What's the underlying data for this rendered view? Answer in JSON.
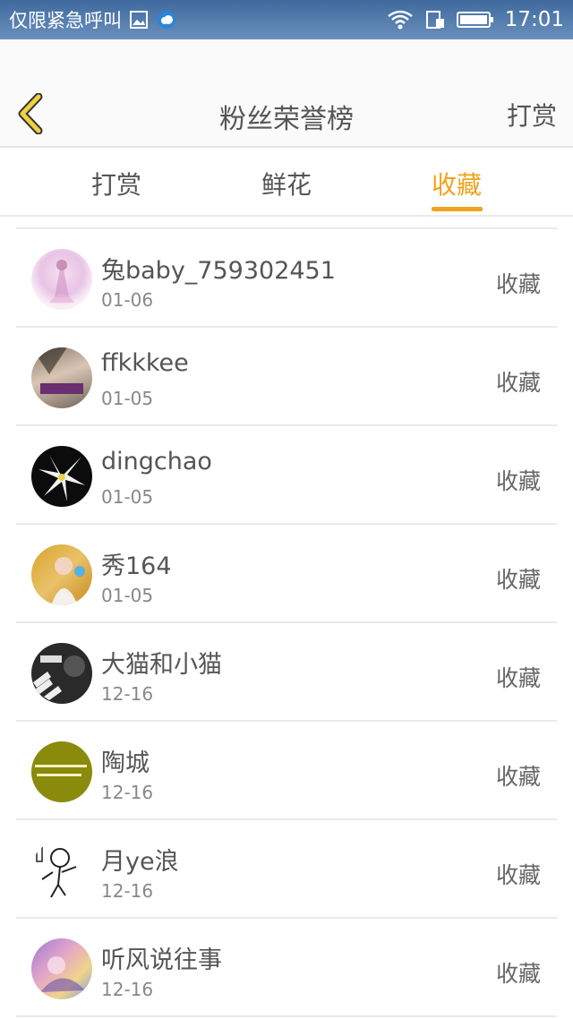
{
  "status_bar": {
    "left_text": "仅限紧急呼叫",
    "time": "17:01"
  },
  "header": {
    "title": "粉丝荣誉榜",
    "action_label": "打赏"
  },
  "tabs": [
    {
      "label": "打赏",
      "active": false
    },
    {
      "label": "鲜花",
      "active": false
    },
    {
      "label": "收藏",
      "active": true
    }
  ],
  "colors": {
    "accent": "#f0a31c",
    "status_bar": "#4a73a6"
  },
  "fans": [
    {
      "name": "兔baby_759302451",
      "date": "01-06",
      "action": "收藏"
    },
    {
      "name": "ffkkkee",
      "date": "01-05",
      "action": "收藏"
    },
    {
      "name": "dingchao",
      "date": "01-05",
      "action": "收藏"
    },
    {
      "name": "秀164",
      "date": "01-05",
      "action": "收藏"
    },
    {
      "name": "大猫和小猫",
      "date": "12-16",
      "action": "收藏"
    },
    {
      "name": "陶城",
      "date": "12-16",
      "action": "收藏"
    },
    {
      "name": "月ye浪",
      "date": "12-16",
      "action": "收藏"
    },
    {
      "name": "听风说往事",
      "date": "12-16",
      "action": "收藏"
    }
  ]
}
